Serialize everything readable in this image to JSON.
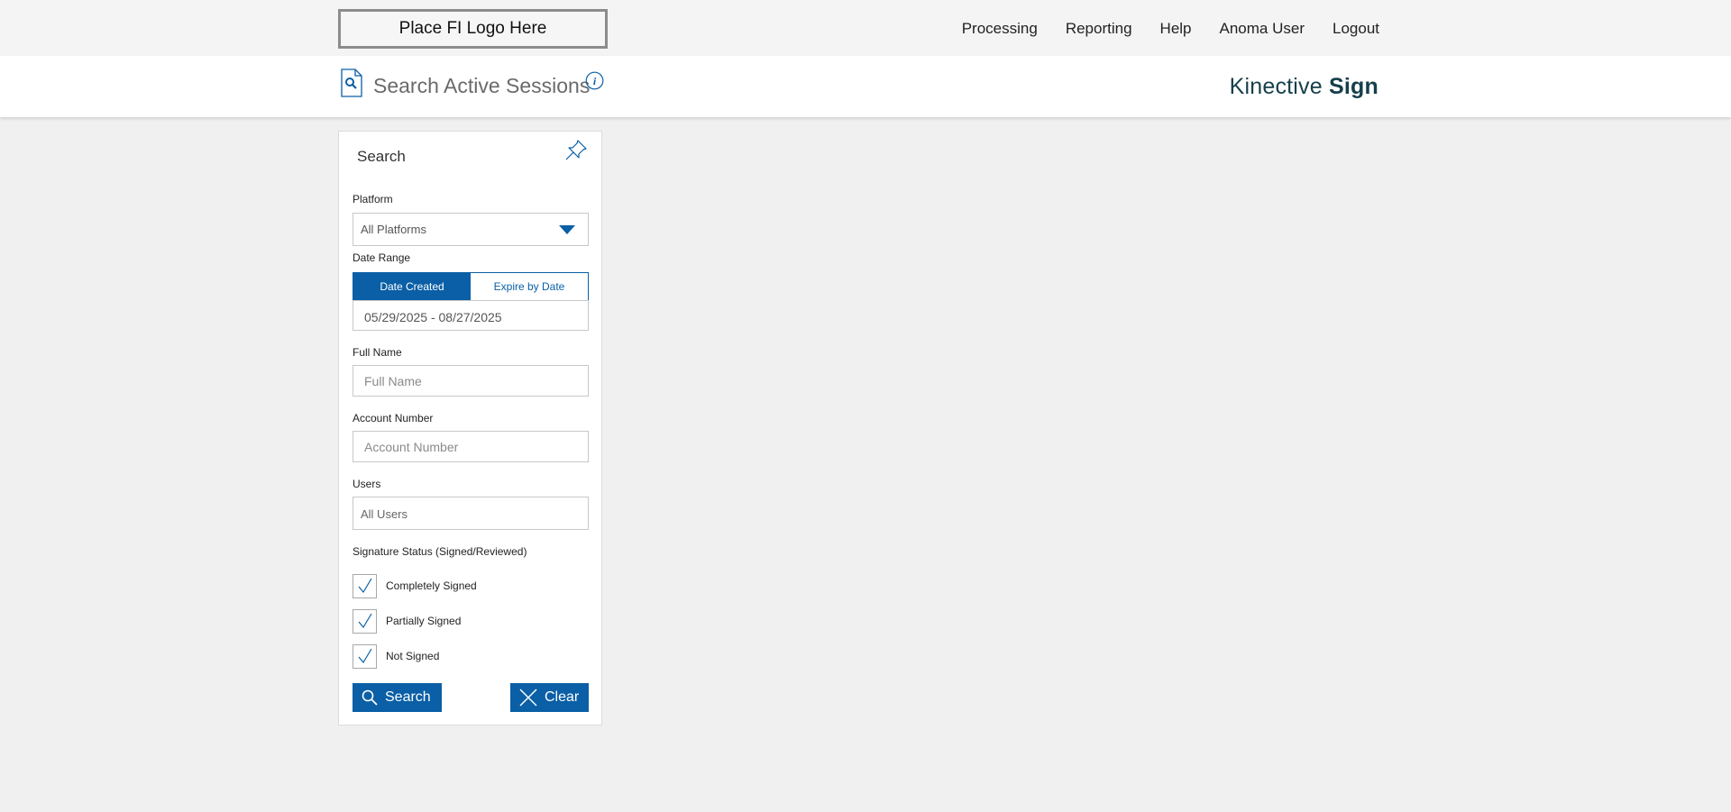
{
  "topbar": {
    "logo_text": "Place FI Logo Here",
    "nav": [
      "Processing",
      "Reporting",
      "Help",
      "Anoma User",
      "Logout"
    ]
  },
  "header": {
    "title": "Search Active Sessions",
    "brand_regular": "Kinective",
    "brand_bold": "Sign"
  },
  "search_panel": {
    "title": "Search",
    "platform": {
      "label": "Platform",
      "value": "All Platforms"
    },
    "date_range": {
      "label": "Date Range",
      "tabs": [
        "Date Created",
        "Expire by Date"
      ],
      "active_tab": "Date Created",
      "value": "05/29/2025 - 08/27/2025"
    },
    "full_name": {
      "label": "Full Name",
      "placeholder": "Full Name",
      "value": ""
    },
    "account_number": {
      "label": "Account Number",
      "placeholder": "Account Number",
      "value": ""
    },
    "users": {
      "label": "Users",
      "value": "All Users"
    },
    "signature_status": {
      "label": "Signature Status (Signed/Reviewed)",
      "options": [
        {
          "label": "Completely Signed",
          "checked": true
        },
        {
          "label": "Partially Signed",
          "checked": true
        },
        {
          "label": "Not Signed",
          "checked": true
        }
      ]
    },
    "search_button": "Search",
    "clear_button": "Clear"
  },
  "colors": {
    "accent": "#0a5fa6",
    "brand": "#153f4b",
    "background": "#f0f0f0"
  },
  "icons": [
    "page-search-icon",
    "info-icon",
    "pin-icon",
    "chevron-down-icon",
    "checkmark-icon",
    "search-icon",
    "close-icon"
  ]
}
